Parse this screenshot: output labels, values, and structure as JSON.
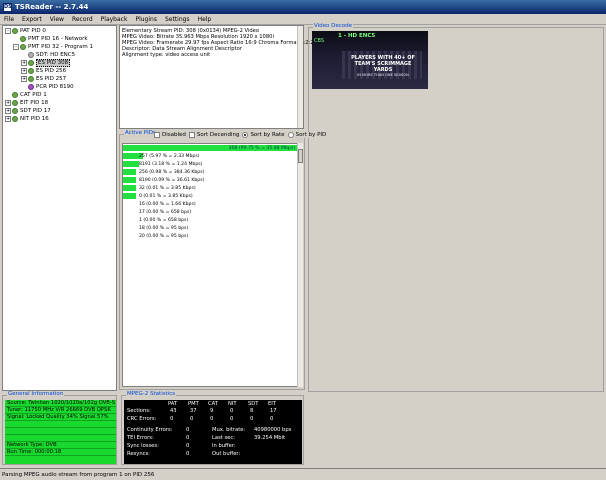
{
  "app": {
    "icon_text": "DS",
    "title": "TSReader -- 2.7.44"
  },
  "menu": [
    "File",
    "Export",
    "View",
    "Record",
    "Playback",
    "Plugins",
    "Settings",
    "Help"
  ],
  "tree": [
    {
      "label": "PAT PID 0",
      "level": 0,
      "exp": "-",
      "node": "green"
    },
    {
      "label": "PMT PID 16 - Network",
      "level": 1,
      "exp": "",
      "node": "green"
    },
    {
      "label": "PMT PID 32 - Program 1",
      "level": 1,
      "exp": "-",
      "node": "green"
    },
    {
      "label": "SDT: HD ENC5",
      "level": 2,
      "exp": "",
      "node": "gray"
    },
    {
      "label": "ES PID 308",
      "level": 2,
      "exp": "+",
      "node": "green",
      "selected": true
    },
    {
      "label": "ES PID 256",
      "level": 2,
      "exp": "+",
      "node": "green"
    },
    {
      "label": "ES PID 257",
      "level": 2,
      "exp": "+",
      "node": "green"
    },
    {
      "label": "PCR PID 8190",
      "level": 2,
      "exp": "",
      "node": "purple"
    },
    {
      "label": "CAT PID 1",
      "level": 0,
      "exp": "",
      "node": "green"
    },
    {
      "label": "EIT PID 18",
      "level": 0,
      "exp": "+",
      "node": "green"
    },
    {
      "label": "SDT PID 17",
      "level": 0,
      "exp": "+",
      "node": "green"
    },
    {
      "label": "NIT PID 16",
      "level": 0,
      "exp": "+",
      "node": "green"
    }
  ],
  "info_lines": [
    "Elementary Stream PID: 308 (0x0134) MPEG-2 Video",
    "MPEG Video: Bitrate 35.963 Mbps Resolution 1920 x 1080i",
    "MPEG Video: Framerate 29.97 fps Aspect Ratio 16:9 Chroma Format 4:2:2",
    "Descriptor: Data Stream Alignment Descriptor",
    " Alignment type: video access unit"
  ],
  "video": {
    "title": "Video Decode",
    "channel": "1 - HD ENC5",
    "logo": "CBS",
    "caption": "PLAYERS WITH 40+ OF TEAM'S SCRIMMAGE YARDS",
    "caption_sub": "IN MORE THAN ONE SEASON"
  },
  "active_pids": {
    "title": "Active PIDs",
    "disabled_label": "Disabled",
    "sort_desc_label": "Sort Decending",
    "sort_rate_label": "Sort by Rate",
    "sort_pid_label": "Sort by PID",
    "rows": [
      {
        "text": "308 (99.75 % = 35.88 Mbps)",
        "pct": 99.75
      },
      {
        "text": "257 (5.97 % = 2.33 Mbps)",
        "pct": 5.97
      },
      {
        "text": "8191 (3.18 % = 1.24 Mbps)",
        "pct": 3.18
      },
      {
        "text": "256 (0.98 % = 384.36 Kbps)",
        "pct": 0.98
      },
      {
        "text": "8190 (0.09 % = 36.61 Kbps)",
        "pct": 0.09
      },
      {
        "text": "32 (0.01 % = 3.85 Kbps)",
        "pct": 0.01
      },
      {
        "text": "0 (0.01 % = 3.85 Kbps)",
        "pct": 0.01
      },
      {
        "text": "16 (0.00 % = 1.66 Kbps)",
        "pct": 0
      },
      {
        "text": "17 (0.00 % = 658 bps)",
        "pct": 0
      },
      {
        "text": "1 (0.00 % = 658 bps)",
        "pct": 0
      },
      {
        "text": "18 (0.00 % = 95 bps)",
        "pct": 0
      },
      {
        "text": "20 (0.00 % = 95 bps)",
        "pct": 0
      }
    ]
  },
  "general": {
    "title": "General Information",
    "lines": [
      "Source: Twinhan 1020/1020a/102g DVB-S",
      "Tuner: 11750 MHz V/R 26669 DVB QPSK",
      "Signal: Locked Quality 34% Signal 57%",
      "",
      "",
      "",
      "Network Type: DVB",
      "Run Time: 000:00:18"
    ]
  },
  "mpeg": {
    "title": "MPEG-2 Statistics",
    "headers": [
      "PAT",
      "PMT",
      "CAT",
      "NIT",
      "SDT",
      "EIT"
    ],
    "sections_label": "Sections:",
    "sections": [
      "43",
      "37",
      "9",
      "0",
      "8",
      "17"
    ],
    "crc_label": "CRC Errors:",
    "crc": [
      "0",
      "0",
      "0",
      "0",
      "0",
      "0"
    ],
    "continuity_label": "Continuity Errors:",
    "continuity": "0",
    "tei_label": "TEI Errors:",
    "tei": "0",
    "sync_label": "Sync losses:",
    "sync": "0",
    "resyncs_label": "Resyncs:",
    "resyncs": "0",
    "mux_label": "Mux. bitrate:",
    "mux": "40980000 bps",
    "lastsec_label": "Last sec:",
    "lastsec": "39.254 Mbit",
    "inbuf_label": "In buffer:",
    "outbuf_label": "Out buffer:"
  },
  "status": "Parsing MPEG audio stream from program 1 on PID 256"
}
